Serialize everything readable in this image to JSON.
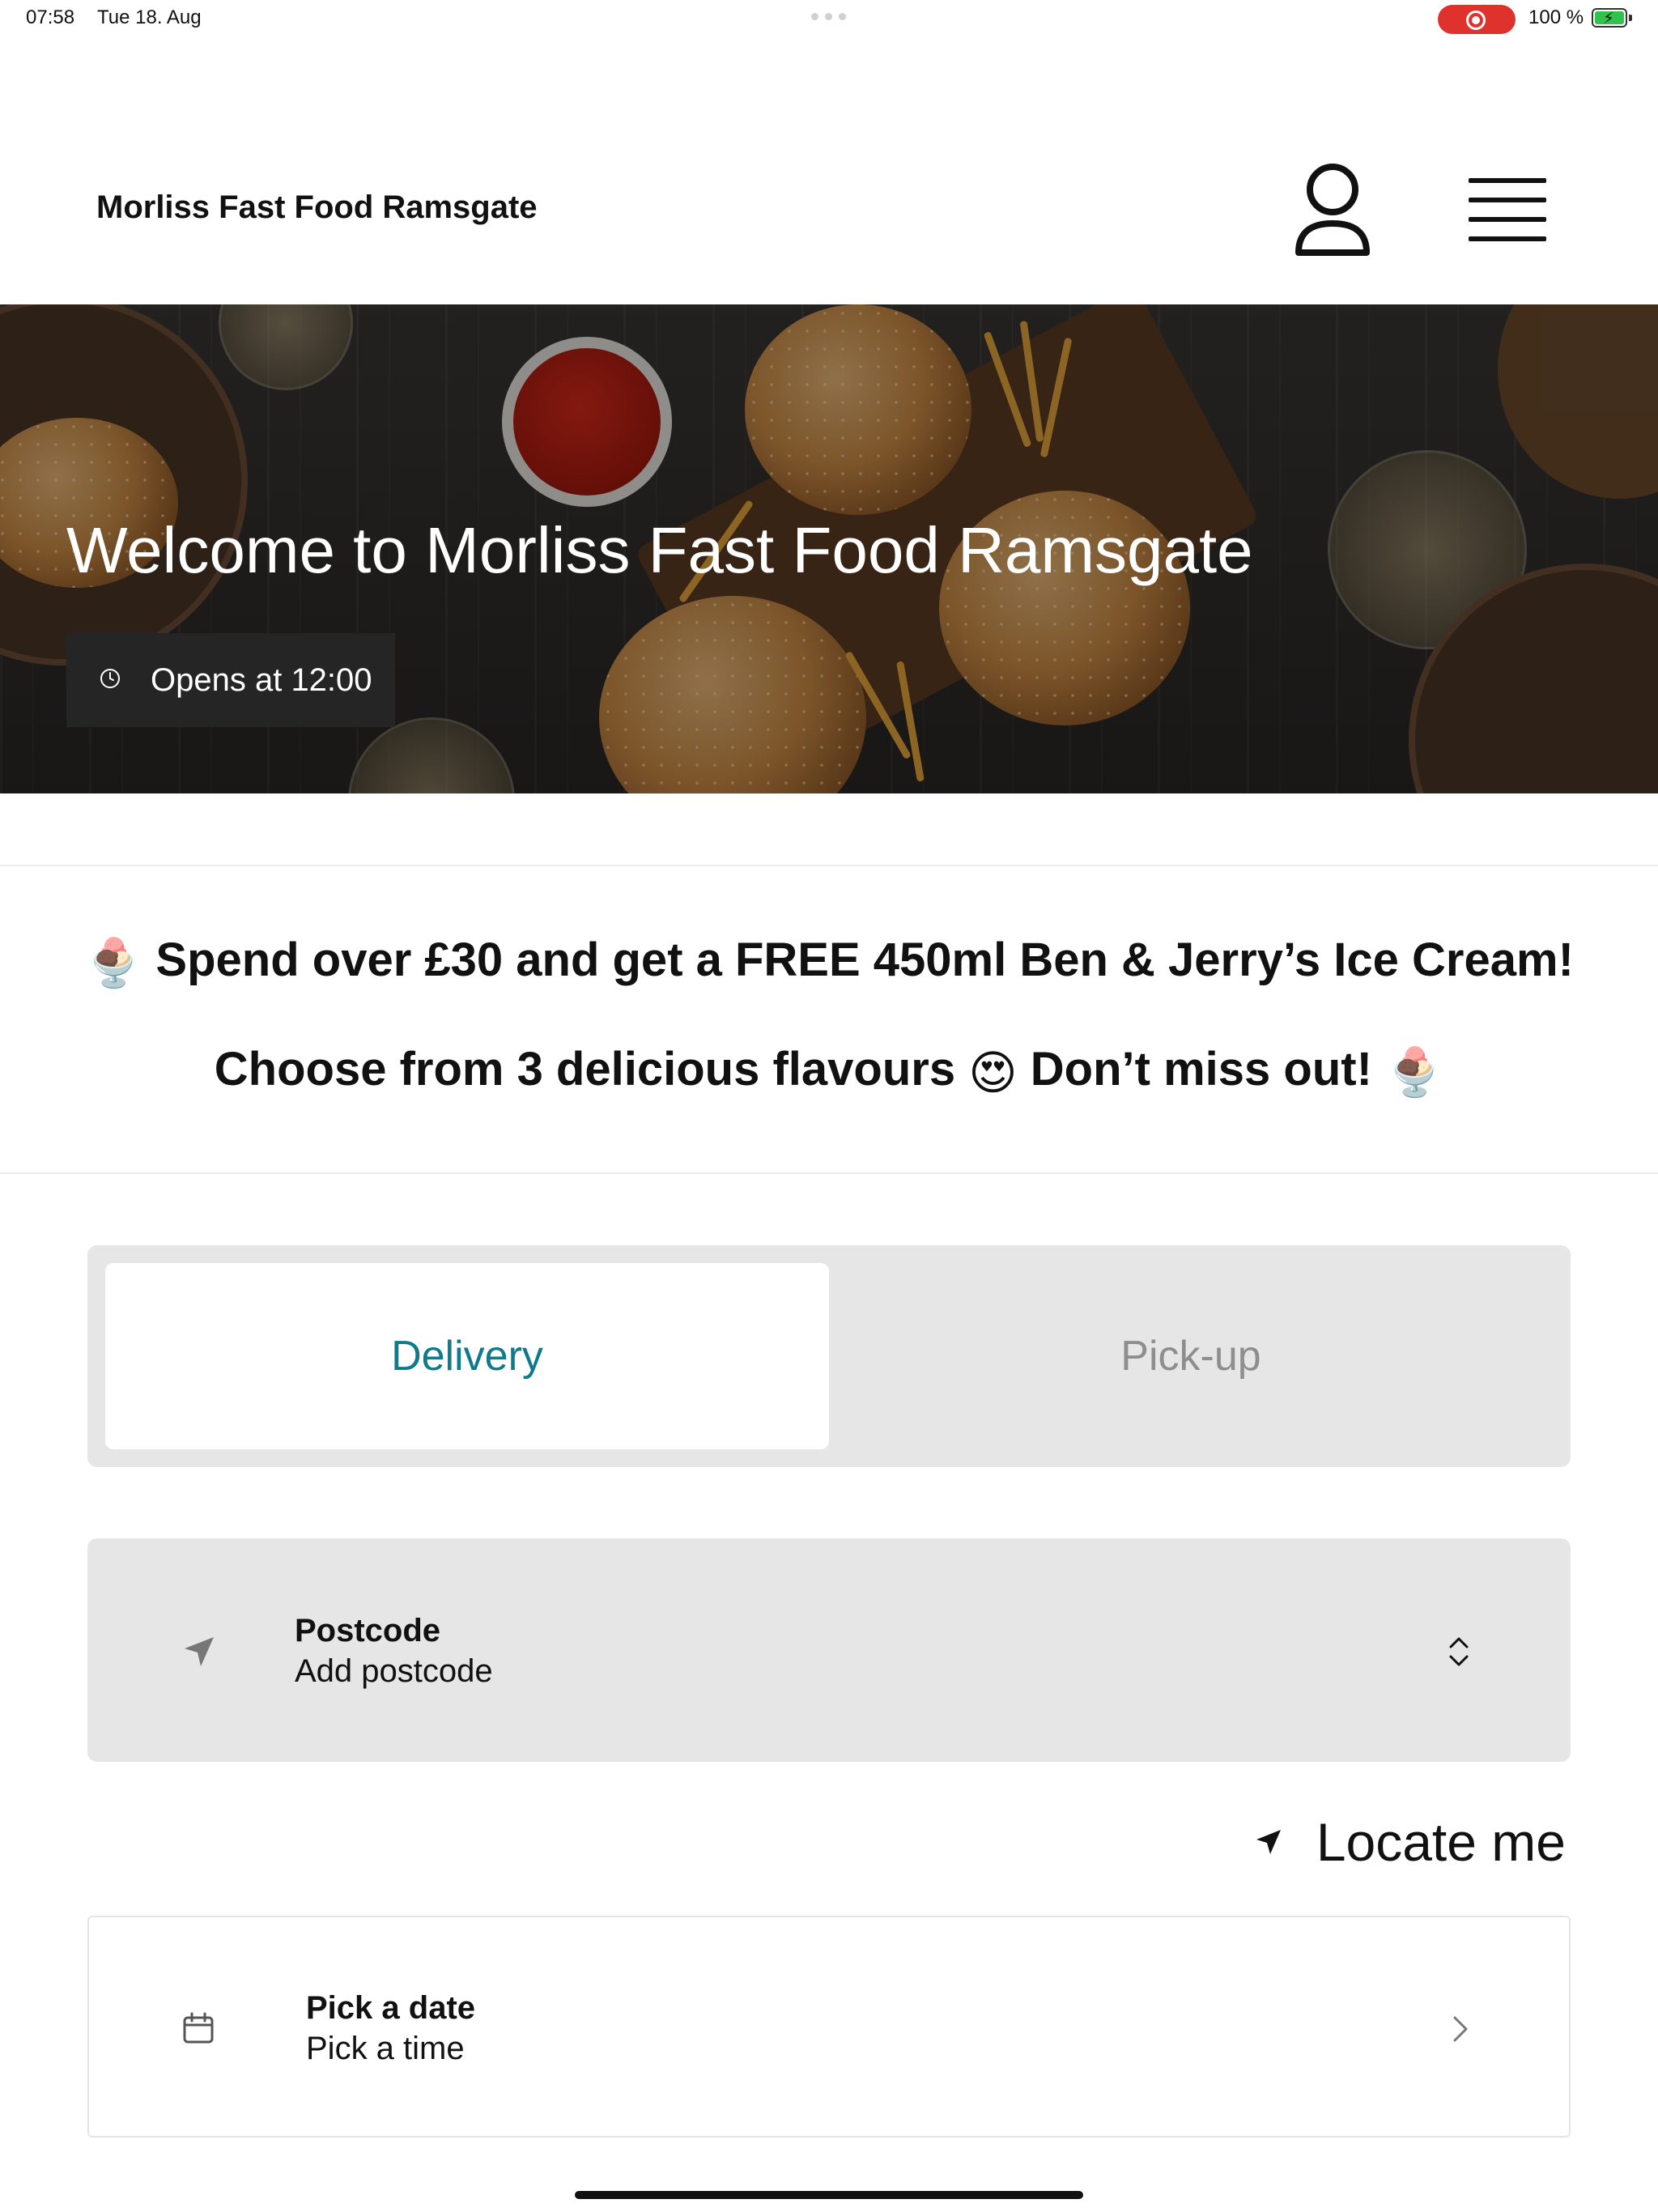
{
  "status_bar": {
    "time": "07:58",
    "date": "Tue 18. Aug",
    "battery": "100 %",
    "recording_color": "#e0322c",
    "battery_color": "#30c24b"
  },
  "header": {
    "brand": "Morliss Fast Food Ramsgate",
    "account_icon": "user-icon",
    "menu_icon": "hamburger-menu-icon"
  },
  "hero": {
    "title": "Welcome to Morliss Fast Food Ramsgate",
    "hours": "Opens at 12:00",
    "hours_icon": "clock-icon"
  },
  "promo": {
    "line1": "Spend over £30 and get a FREE 450ml Ben & Jerry’s Ice Cream!",
    "line2_a": "Choose from 3 delicious flavours",
    "line2_b": "Don’t miss out!",
    "emoji_ice_cream": "🍨",
    "emoji_heart_eyes": "😍"
  },
  "order_type": {
    "tabs": [
      {
        "label": "Delivery",
        "selected": true
      },
      {
        "label": "Pick-up",
        "selected": false
      }
    ],
    "accent_color": "#0f7a8c"
  },
  "postcode": {
    "label": "Postcode",
    "placeholder": "Add postcode",
    "icon": "location-arrow-icon",
    "selector_icon": "chevron-up-down-icon"
  },
  "locate": {
    "label": "Locate me",
    "icon": "location-arrow-icon"
  },
  "schedule": {
    "label": "Pick a date",
    "sublabel": "Pick a time",
    "icon": "calendar-icon",
    "chevron_icon": "chevron-right-icon"
  }
}
